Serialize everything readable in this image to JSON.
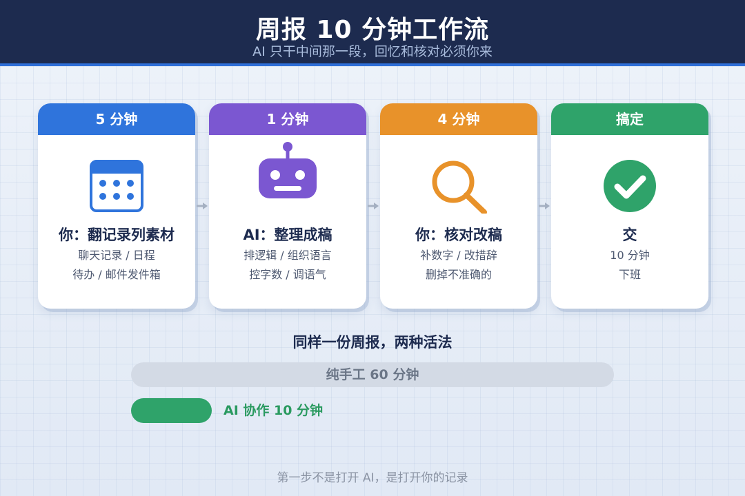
{
  "header": {
    "title": "周报 10 分钟工作流",
    "subtitle": "AI 只干中间那一段，回忆和核对必须你来"
  },
  "steps": [
    {
      "time_label": "5 分钟",
      "title": "你：翻记录列素材",
      "line1": "聊天记录 / 日程",
      "line2": "待办 / 邮件发件箱",
      "icon": "calendar-icon",
      "color": "#2f74dc"
    },
    {
      "time_label": "1 分钟",
      "title": "AI：整理成稿",
      "line1": "排逻辑 / 组织语言",
      "line2": "控字数 / 调语气",
      "icon": "robot-icon",
      "color": "#7b57d1"
    },
    {
      "time_label": "4 分钟",
      "title": "你：核对改稿",
      "line1": "补数字 / 改措辞",
      "line2": "删掉不准确的",
      "icon": "magnifier-icon",
      "color": "#e8922a"
    },
    {
      "time_label": "搞定",
      "title": "交",
      "line1": "10 分钟",
      "line2": "下班",
      "icon": "checkmark-icon",
      "color": "#2fa36a"
    }
  ],
  "comparison": {
    "title": "同样一份周报，两种活法",
    "manual_label": "纯手工  60 分钟",
    "manual_minutes": 60,
    "ai_label": "AI 协作  10 分钟",
    "ai_minutes": 10,
    "manual_color": "#d3dae5",
    "ai_color": "#2fa36a"
  },
  "footer": "第一步不是打开 AI，是打开你的记录"
}
